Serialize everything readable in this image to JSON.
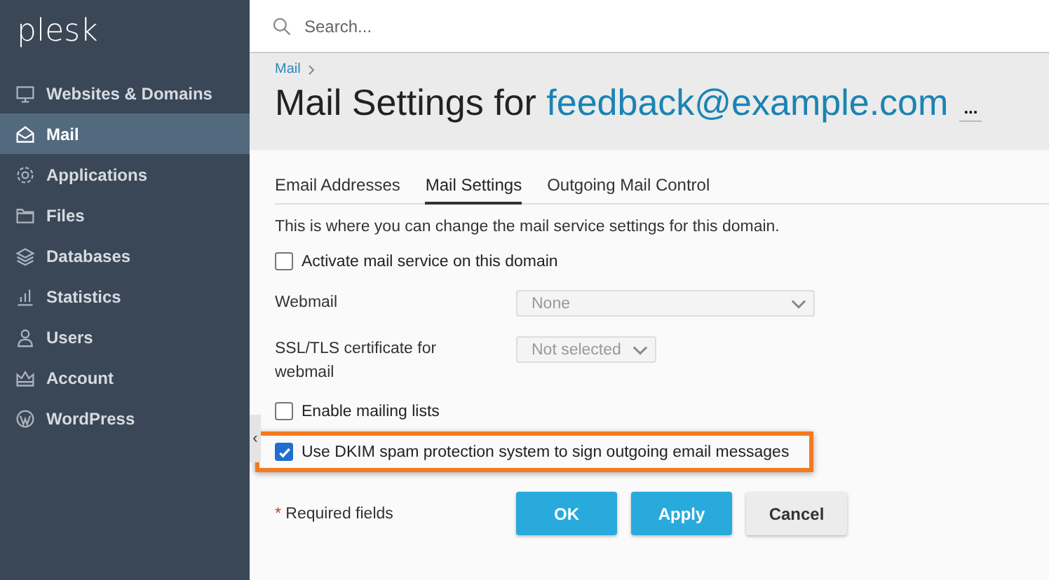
{
  "logo": "plesk",
  "sidebar": {
    "items": [
      {
        "label": "Websites & Domains",
        "selected": false
      },
      {
        "label": "Mail",
        "selected": true
      },
      {
        "label": "Applications",
        "selected": false
      },
      {
        "label": "Files",
        "selected": false
      },
      {
        "label": "Databases",
        "selected": false
      },
      {
        "label": "Statistics",
        "selected": false
      },
      {
        "label": "Users",
        "selected": false
      },
      {
        "label": "Account",
        "selected": false
      },
      {
        "label": "WordPress",
        "selected": false
      }
    ]
  },
  "search": {
    "placeholder": "Search..."
  },
  "breadcrumb": [
    "Mail"
  ],
  "title": {
    "prefix": "Mail Settings for",
    "domain": "feedback@example.com",
    "more": "..."
  },
  "tabs": [
    {
      "label": "Email Addresses",
      "selected": false
    },
    {
      "label": "Mail Settings",
      "selected": true
    },
    {
      "label": "Outgoing Mail Control",
      "selected": false
    }
  ],
  "description": "This is where you can change the mail service settings for this domain.",
  "form": [
    {
      "kind": "checkbox",
      "label": "Activate mail service on this domain",
      "checked": false,
      "highlighted": false
    },
    {
      "kind": "select",
      "label": "Webmail",
      "value": "None",
      "disabled": true
    },
    {
      "kind": "select",
      "label": "SSL/TLS certificate for webmail",
      "value": "Not selected",
      "disabled": true
    },
    {
      "kind": "checkbox",
      "label": "Enable mailing lists",
      "checked": false,
      "highlighted": false
    },
    {
      "kind": "checkbox",
      "label": "Use DKIM spam protection system to sign outgoing email messages",
      "checked": true,
      "highlighted": true
    }
  ],
  "required_note": {
    "mark": "*",
    "text": "Required fields"
  },
  "buttons": [
    {
      "label": "OK",
      "primary": true
    },
    {
      "label": "Apply",
      "primary": true
    },
    {
      "label": "Cancel",
      "primary": false
    }
  ],
  "collapse_handle": "‹"
}
